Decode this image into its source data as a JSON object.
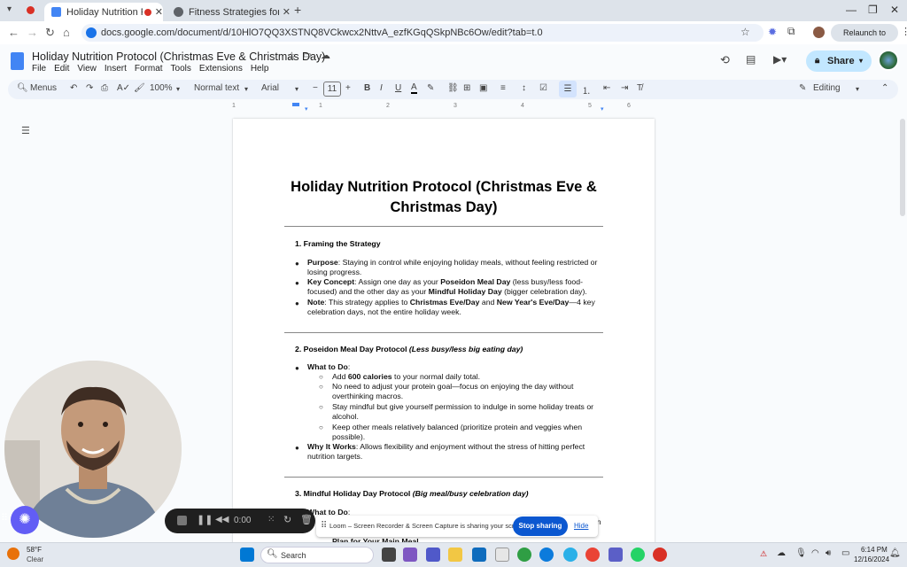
{
  "browser": {
    "tabs": [
      {
        "title": "Holiday Nutrition Protocol (C...",
        "active": true,
        "favicon_color": "#4285f4"
      },
      {
        "title": "Fitness Strategies for Professio...",
        "active": false,
        "favicon_color": "#5f6368"
      }
    ],
    "url": "docs.google.com/document/d/10HlO7QQ3XSTNQ8VCkwcx2NttvA_ezfKGqQSkpNBc6Ow/edit?tab=t.0",
    "relaunch_label": "Relaunch to update"
  },
  "docs": {
    "title": "Holiday Nutrition Protocol (Christmas Eve & Christmas Day)",
    "menu": [
      "File",
      "Edit",
      "View",
      "Insert",
      "Format",
      "Tools",
      "Extensions",
      "Help"
    ],
    "share_label": "Share",
    "toolbar": {
      "menus_label": "Menus",
      "zoom": "100%",
      "style": "Normal text",
      "font": "Arial",
      "font_size": "11",
      "mode": "Editing"
    },
    "ruler_ticks": [
      "1",
      "1",
      "2",
      "3",
      "4",
      "5",
      "6",
      "7"
    ]
  },
  "document": {
    "heading": "Holiday Nutrition Protocol (Christmas Eve & Christmas Day)",
    "sec1_title": "1. Framing the Strategy",
    "s1_b1_bold": "Purpose",
    "s1_b1_text": ": Staying in control while enjoying holiday meals, without feeling restricted or losing progress.",
    "s1_b2_bold": "Key Concept",
    "s1_b2_t1": ": Assign one day as your ",
    "s1_b2_b2": "Poseidon Meal Day",
    "s1_b2_t2": " (less busy/less food-focused) and the other day as your ",
    "s1_b2_b3": "Mindful Holiday Day",
    "s1_b2_t3": " (bigger celebration day).",
    "s1_b3_bold": "Note",
    "s1_b3_t1": ": This strategy applies to ",
    "s1_b3_b2": "Christmas Eve/Day",
    "s1_b3_t2": " and ",
    "s1_b3_b3": "New Year's Eve/Day",
    "s1_b3_t3": "—4 key celebration days, not the entire holiday week.",
    "sec2_title": "2. Poseidon Meal Day Protocol ",
    "sec2_sub": "(Less busy/less big eating day)",
    "s2_what": "What to Do",
    "s2_c1_t1": "Add ",
    "s2_c1_b": "600 calories",
    "s2_c1_t2": " to your normal daily total.",
    "s2_c2": "No need to adjust your protein goal—focus on enjoying the day without overthinking macros.",
    "s2_c3": "Stay mindful but give yourself permission to indulge in some holiday treats or alcohol.",
    "s2_c4": "Keep other meals relatively balanced (prioritize protein and veggies when possible).",
    "s2_why_bold": "Why It Works",
    "s2_why_text": ": Allows flexibility and enjoyment without the stress of hitting perfect nutrition targets.",
    "sec3_title": "3. Mindful Holiday Day Protocol ",
    "sec3_sub": "(Big meal/busy celebration day)",
    "s3_what": "What to Do",
    "s3_plan": "Plan for Your Main Meal",
    "s3_tail": "ein"
  },
  "loom": {
    "timer": "0:00",
    "sharing_text": "Loom – Screen Recorder & Screen Capture is sharing your screen.",
    "stop_label": "Stop sharing",
    "hide_label": "Hide"
  },
  "taskbar": {
    "weather_temp": "58°F",
    "weather_desc": "Clear",
    "search_placeholder": "Search",
    "time": "6:14 PM",
    "date": "12/16/2024"
  }
}
